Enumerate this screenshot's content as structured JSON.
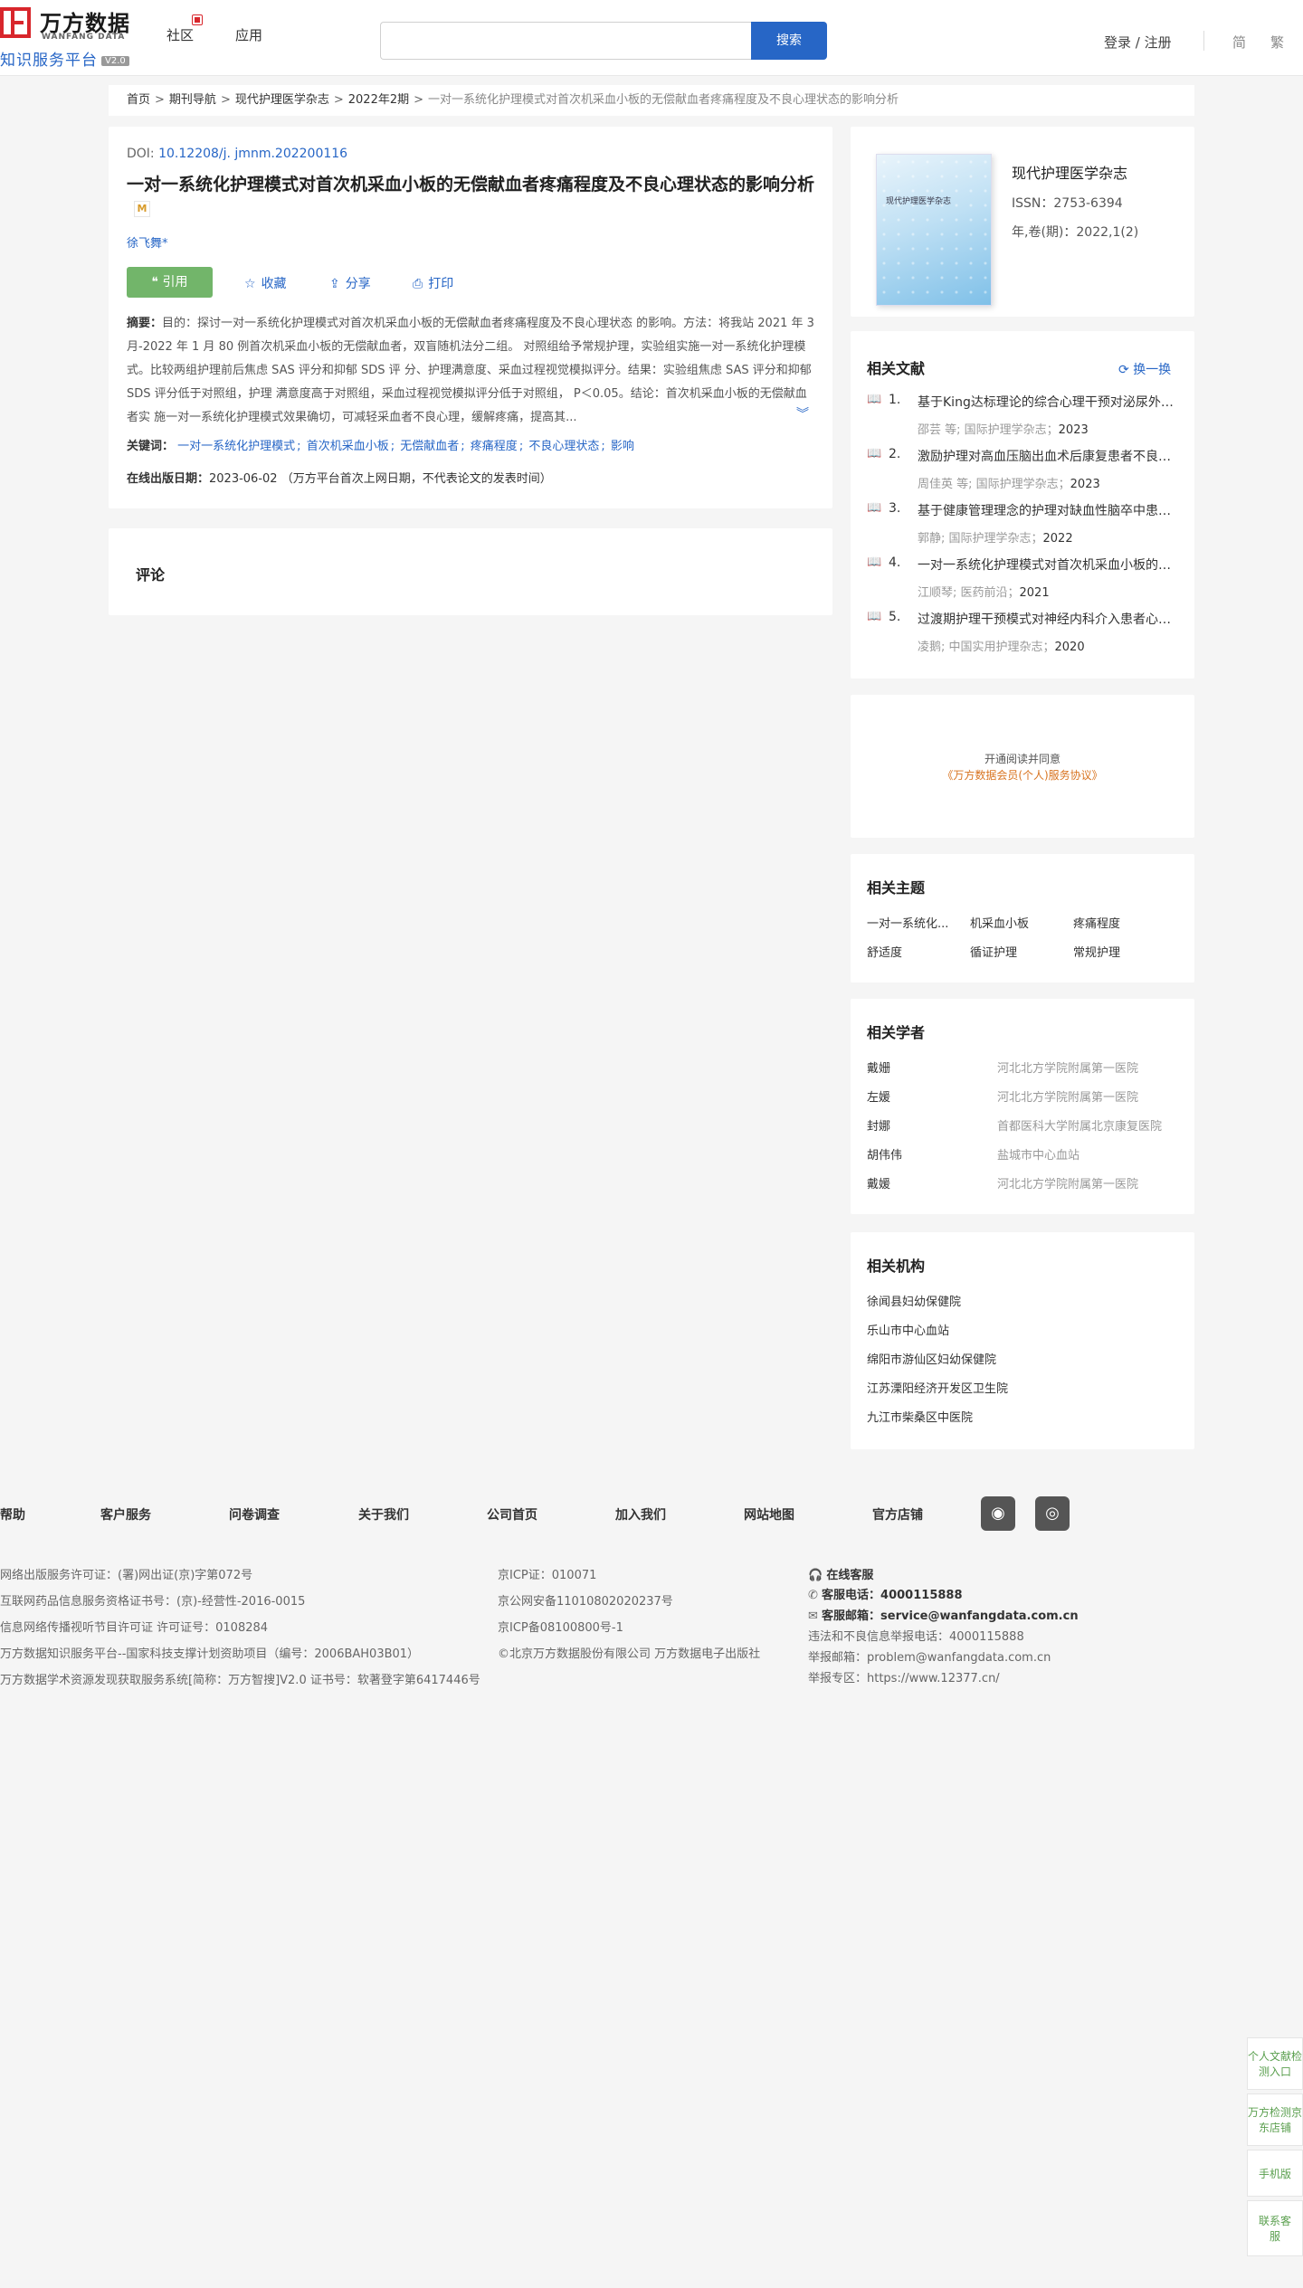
{
  "header": {
    "logo_title": "万方数据",
    "logo_en": "WANFANG DATA",
    "logo_sub": "知识服务平台",
    "logo_version": "V2.0",
    "nav": [
      "社区",
      "应用"
    ],
    "search_placeholder": "",
    "search_button": "搜索",
    "login": "登录 / 注册",
    "lang_simple": "简",
    "lang_traditional": "繁"
  },
  "breadcrumb": {
    "items": [
      "首页",
      "期刊导航",
      "现代护理医学杂志",
      "2022年2期"
    ],
    "current": "一对一系统化护理模式对首次机采血小板的无偿献血者疼痛程度及不良心理状态的影响分析",
    "separator": ">"
  },
  "article": {
    "doi_label": "DOI: ",
    "doi": "10.12208/j. jmnm.202200116",
    "title": "一对一系统化护理模式对首次机采血小板的无偿献血者疼痛程度及不良心理状态的影响分析",
    "badge": "M",
    "author": "徐飞舞*",
    "cite_label": "引用",
    "collect_label": "收藏",
    "share_label": "分享",
    "print_label": "打印",
    "abstract_label": "摘要：",
    "abstract": "目的：探讨一对一系统化护理模式对首次机采血小板的无偿献血者疼痛程度及不良心理状态 的影响。方法：将我站 2021 年 3 月-2022 年 1 月 80 例首次机采血小板的无偿献血者，双盲随机法分二组。 对照组给予常规护理，实验组实施一对一系统化护理模式。比较两组护理前后焦虑 SAS 评分和抑郁 SDS 评 分、护理满意度、采血过程视觉模拟评分。结果：实验组焦虑 SAS 评分和抑郁 SDS 评分低于对照组，护理 满意度高于对照组，采血过程视觉模拟评分低于对照组， P＜0.05。结论：首次机采血小板的无偿献血者实 施一对一系统化护理模式效果确切，可减轻采血者不良心理，缓解疼痛，提高其...",
    "keywords_label": "关键词：",
    "keywords": [
      "一对一系统化护理模式",
      "首次机采血小板",
      "无偿献血者",
      "疼痛程度",
      "不良心理状态",
      "影响"
    ],
    "pubdate_label": "在线出版日期：",
    "pubdate": "2023-06-02",
    "pubdate_note": "（万方平台首次上网日期，不代表论文的发表时间）"
  },
  "comment": {
    "title": "评论"
  },
  "journal": {
    "cover_text": "现代护理医学杂志",
    "name": "现代护理医学杂志",
    "issn": "ISSN：2753-6394",
    "year": "年,卷(期)：2022,1(2)"
  },
  "related": {
    "title": "相关文献",
    "refresh": "换一换",
    "items": [
      {
        "num": "1.",
        "title": "基于King达标理论的综合心理干预对泌尿外科手术患者...",
        "meta": "邵芸  等; 国际护理学杂志；",
        "year": "2023"
      },
      {
        "num": "2.",
        "title": "激励护理对高血压脑出血术后康复患者不良心理状态...",
        "meta": "周佳英  等; 国际护理学杂志；",
        "year": "2023"
      },
      {
        "num": "3.",
        "title": "基于健康管理理念的护理对缺血性脑卒中患者...",
        "meta": "郭静; 国际护理学杂志；",
        "year": "2022"
      },
      {
        "num": "4.",
        "title": "一对一系统化护理模式对首次机采血小板的无偿献血者...",
        "meta": "江顺琴; 医药前沿；",
        "year": "2021"
      },
      {
        "num": "5.",
        "title": "过渡期护理干预模式对神经内科介入患者心理状态...",
        "meta": "凌鹅; 中国实用护理杂志；",
        "year": "2020"
      }
    ]
  },
  "agreement": {
    "line1": "开通阅读并同意",
    "line2": "《万方数据会员(个人)服务协议》"
  },
  "topics": {
    "title": "相关主题",
    "tags": [
      "一对一系统化...",
      "机采血小板",
      "疼痛程度",
      "舒适度",
      "循证护理",
      "常规护理"
    ]
  },
  "scholars": {
    "title": "相关学者",
    "items": [
      {
        "name": "戴姗",
        "org": "河北北方学院附属第一医院"
      },
      {
        "name": "左媛",
        "org": "河北北方学院附属第一医院"
      },
      {
        "name": "封娜",
        "org": "首都医科大学附属北京康复医院"
      },
      {
        "name": "胡伟伟",
        "org": "盐城市中心血站"
      },
      {
        "name": "戴媛",
        "org": "河北北方学院附属第一医院"
      }
    ]
  },
  "orgs": {
    "title": "相关机构",
    "items": [
      "徐闻县妇幼保健院",
      "乐山市中心血站",
      "绵阳市游仙区妇幼保健院",
      "江苏溧阳经济开发区卫生院",
      "九江市柴桑区中医院"
    ]
  },
  "footer": {
    "links": [
      "帮助",
      "客户服务",
      "问卷调查",
      "关于我们",
      "公司首页",
      "加入我们",
      "网站地图",
      "官方店铺"
    ],
    "col1": [
      "网络出版服务许可证：(署)网出证(京)字第072号",
      "互联网药品信息服务资格证书号：(京)-经营性-2016-0015",
      "信息网络传播视听节目许可证 许可证号：0108284",
      "万方数据知识服务平台--国家科技支撑计划资助项目（编号：2006BAH03B01）",
      "万方数据学术资源发现获取服务系统[简称：万方智搜]V2.0 证书号：软著登字第6417446号"
    ],
    "col2": [
      "京ICP证：010071",
      "京公网安备11010802020237号",
      "京ICP备08100800号-1",
      "©北京万方数据股份有限公司 万方数据电子出版社"
    ],
    "online_service": "在线客服",
    "phone_label": "客服电话：",
    "phone": "4000115888",
    "email_label": "客服邮箱：",
    "email": "service@wanfangdata.com.cn",
    "report_phone": "违法和不良信息举报电话：4000115888",
    "report_email": "举报邮箱：problem@wanfangdata.com.cn",
    "report_zone": "举报专区：https://www.12377.cn/"
  },
  "sidebar": {
    "items": [
      "个人文献检测入口",
      "万方检测京东店铺",
      "手机版",
      "联系客服"
    ]
  }
}
